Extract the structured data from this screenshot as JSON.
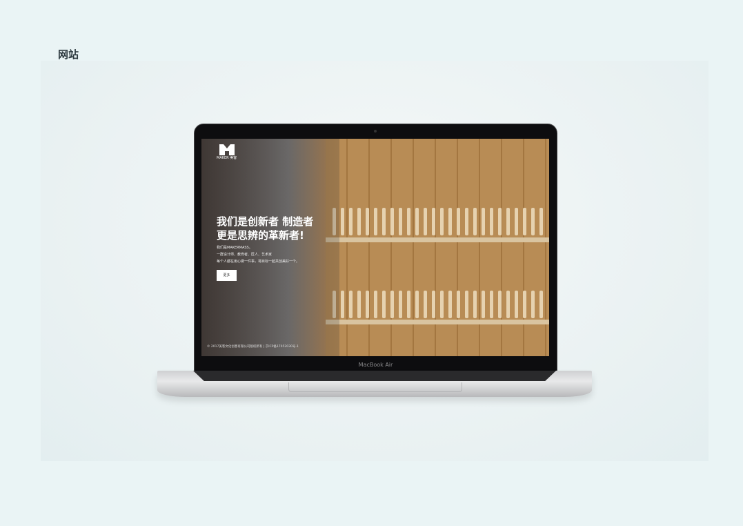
{
  "page": {
    "title": "网站"
  },
  "site": {
    "logo_text": "MAKER 美客",
    "headline_1": "我们是创新者 制造者",
    "headline_2": "更是思辨的革新者!",
    "intro": [
      "我们是MAKERMASS。",
      "一群设计师、教育者、匠人、艺术家",
      "每个人都在用心做一件事，将目标一起共创美好一个。"
    ],
    "more_button": "更多",
    "footer": "© 2017美客文化创意有限公司版权所有 | 京ICP备17052030号-1"
  },
  "device": {
    "brand": "MacBook Air"
  }
}
